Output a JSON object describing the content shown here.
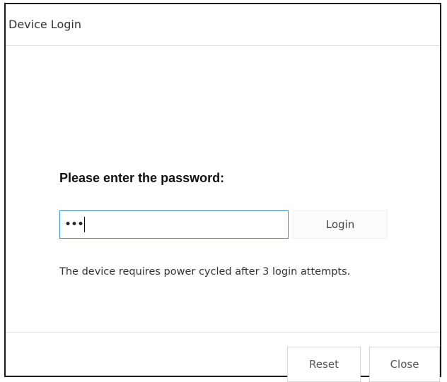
{
  "dialog": {
    "title": "Device Login",
    "prompt": "Please enter the password:",
    "password": {
      "masked_value": "•••",
      "character_count": 3
    },
    "login_button_label": "Login",
    "notice": "The device requires power cycled after 3 login attempts.",
    "footer": {
      "reset_label": "Reset",
      "close_label": "Close"
    }
  }
}
